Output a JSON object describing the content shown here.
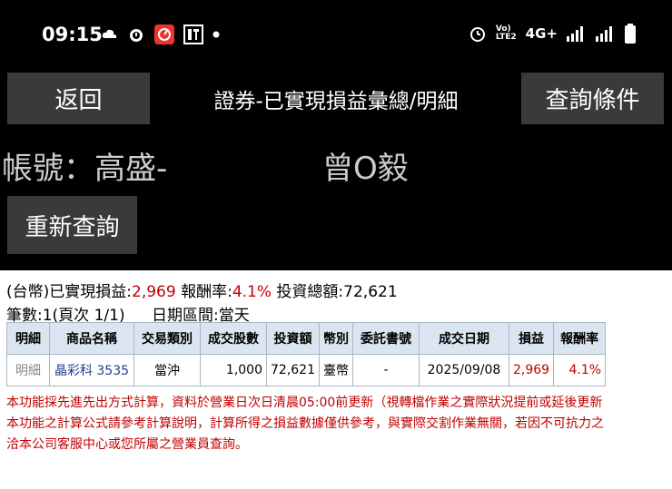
{
  "status_bar": {
    "time": "09:15",
    "network": "4G+",
    "lte_label": "LTE2",
    "icons_left": [
      "cloud-icon",
      "alarm-icon",
      "app-icon",
      "app2-icon",
      "dot-icon"
    ],
    "icons_right": [
      "alarm-icon",
      "volte-icon",
      "signal-icon",
      "signal-icon",
      "battery-icon"
    ]
  },
  "header": {
    "back_label": "返回",
    "title": "證券-已實現損益彙總/明細",
    "query_label": "查詢條件"
  },
  "account": {
    "label": "帳號：高盛-",
    "owner": "曾O毅"
  },
  "requery_label": "重新查詢",
  "summary": {
    "currency_prefix": "(台幣)已實現損益:",
    "pnl": "2,969",
    "return_label": "報酬率:",
    "return_value": "4.1%",
    "invest_label": "投資總額:",
    "invest_value": "72,621"
  },
  "count_line": {
    "count": "筆數:1(頁次 1/1)",
    "range": "日期區間:當天"
  },
  "table": {
    "headers": [
      "明細",
      "商品名稱",
      "交易類別",
      "成交股數",
      "投資額",
      "幣別",
      "委託書號",
      "成交日期",
      "損益",
      "報酬率"
    ],
    "rows": [
      {
        "detail": "明細",
        "product": "晶彩科 3535",
        "trade_type": "當沖",
        "shares": "1,000",
        "investment": "72,621",
        "currency": "臺幣",
        "order_no": "-",
        "date": "2025/09/08",
        "pnl": "2,969",
        "return": "4.1%"
      }
    ]
  },
  "notes": [
    "本功能採先進先出方式計算，資料於營業日次日清晨05:00前更新（視轉檔作業之實際狀況提前或延後更新",
    "本功能之計算公式請參考計算說明，計算所得之損益數據僅供參考，與實際交割作業無關，若因不可抗力之",
    "洽本公司客服中心或您所屬之營業員查詢。"
  ],
  "colors": {
    "accent_red": "#c00000",
    "header_bg": "#dbe5f1",
    "link_blue": "#1f3f8f",
    "button_gray": "#3a3a3a"
  }
}
